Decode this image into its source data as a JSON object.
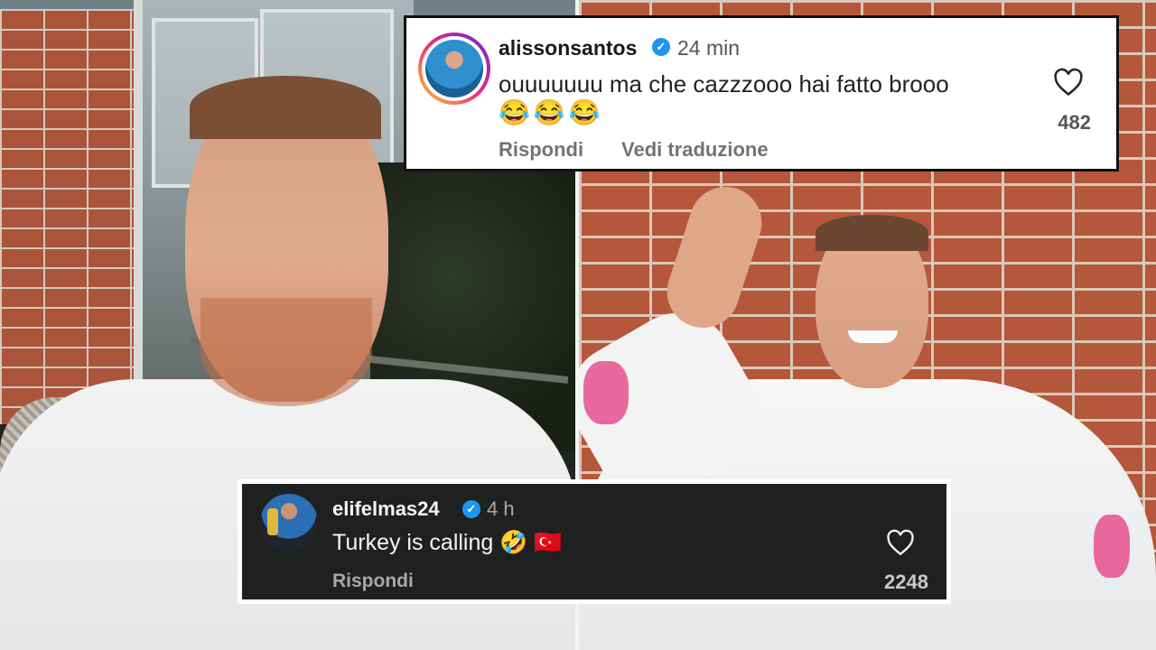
{
  "comments": [
    {
      "username": "alissonsantos",
      "verified": true,
      "verified_icon": "verified-badge-icon",
      "timestamp": "24 min",
      "text": "ouuuuuuu ma che cazzzooo hai fatto brooo",
      "emojis": "😂😂😂",
      "reply_label": "Rispondi",
      "translate_label": "Vedi traduzione",
      "likes": "482",
      "like_icon": "heart-outline-icon",
      "theme": "light"
    },
    {
      "username": "elifelmas24",
      "verified": true,
      "verified_icon": "verified-badge-icon",
      "timestamp": "4 h",
      "text": "Turkey is calling 🤣 🇹🇷",
      "reply_label": "Rispondi",
      "likes": "2248",
      "like_icon": "heart-outline-icon",
      "theme": "dark"
    }
  ],
  "colors": {
    "verified_blue": "#1c96ee",
    "light_card_bg": "#ffffff",
    "dark_card_bg": "#1f2020",
    "muted_text": "#737373"
  }
}
